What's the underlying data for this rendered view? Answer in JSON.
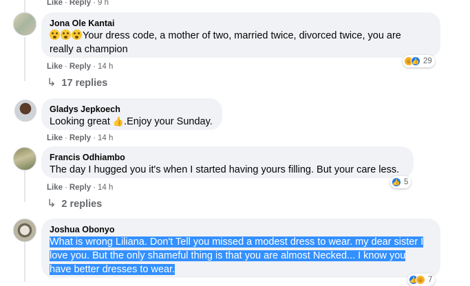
{
  "top_actions": {
    "like": "Like",
    "reply": "Reply",
    "time": "9 h"
  },
  "comments": [
    {
      "author": "Jona Ole Kantai",
      "text_line1": "Your dress code, a mother of two, married twice, divorced twice, you are",
      "text_line2": "really a champion",
      "emoji_icon": "flushed-face-icon",
      "actions": {
        "like": "Like",
        "reply": "Reply",
        "time": "14 h"
      },
      "reactions": {
        "count": "29",
        "icons": [
          "haha-icon",
          "like-icon"
        ]
      },
      "replies_label": "17 replies"
    },
    {
      "author": "Gladys Jepkoech",
      "text_before": "Looking great ",
      "text_after": ".Enjoy your Sunday.",
      "emoji_icon": "thumbs-up-emoji-icon",
      "actions": {
        "like": "Like",
        "reply": "Reply",
        "time": "14 h"
      }
    },
    {
      "author": "Francis Odhiambo",
      "text_line1": "The day I hugged you it's when I started having yours filling. But your care less.",
      "actions": {
        "like": "Like",
        "reply": "Reply",
        "time": "14 h"
      },
      "reactions": {
        "count": "5",
        "icons": [
          "like-icon"
        ]
      },
      "replies_label": "2 replies"
    },
    {
      "author": "Joshua Obonyo",
      "text_line1": "What is wrong Liliana. Don't Tell you missed a modest dress to wear. my dear sister I",
      "text_line2": "love you. But the only shameful thing is that you are almost Necked... I know you",
      "text_line3": "have better dresses to wear.",
      "reactions": {
        "count": "7",
        "icons": [
          "like-icon",
          "haha-icon"
        ]
      }
    }
  ],
  "colors": {
    "bubble": "#f0f2f5",
    "meta": "#65676b",
    "selection": "#3390ff",
    "like": "#1877f2"
  }
}
